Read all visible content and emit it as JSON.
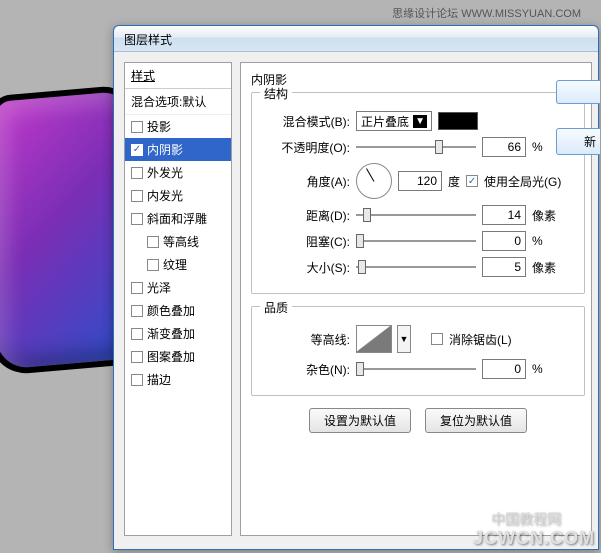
{
  "credits": {
    "top": "思缘设计论坛  WWW.MISSYUAN.COM",
    "bottom_cn": "中国教程网",
    "bottom": "JCWCN.COM"
  },
  "dialog": {
    "title": "图层样式",
    "leftHeader": "样式",
    "leftSub": "混合选项:默认",
    "styles": [
      {
        "label": "投影",
        "checked": false,
        "selected": false
      },
      {
        "label": "内阴影",
        "checked": true,
        "selected": true
      },
      {
        "label": "外发光",
        "checked": false,
        "selected": false
      },
      {
        "label": "内发光",
        "checked": false,
        "selected": false
      },
      {
        "label": "斜面和浮雕",
        "checked": false,
        "selected": false
      },
      {
        "label": "等高线",
        "checked": false,
        "selected": false,
        "indent": true
      },
      {
        "label": "纹理",
        "checked": false,
        "selected": false,
        "indent": true
      },
      {
        "label": "光泽",
        "checked": false,
        "selected": false
      },
      {
        "label": "颜色叠加",
        "checked": false,
        "selected": false
      },
      {
        "label": "渐变叠加",
        "checked": false,
        "selected": false
      },
      {
        "label": "图案叠加",
        "checked": false,
        "selected": false
      },
      {
        "label": "描边",
        "checked": false,
        "selected": false
      }
    ],
    "panelTitle": "内阴影",
    "structure": {
      "legend": "结构",
      "blendLabel": "混合模式(B):",
      "blendValue": "正片叠底",
      "opacityLabel": "不透明度(O):",
      "opacityValue": "66",
      "opacityUnit": "%",
      "angleLabel": "角度(A):",
      "angleValue": "120",
      "angleUnit": "度",
      "globalLightLabel": "使用全局光(G)",
      "globalLightChecked": true,
      "distanceLabel": "距离(D):",
      "distanceValue": "14",
      "distanceUnit": "像素",
      "chokeLabel": "阻塞(C):",
      "chokeValue": "0",
      "chokeUnit": "%",
      "sizeLabel": "大小(S):",
      "sizeValue": "5",
      "sizeUnit": "像素"
    },
    "quality": {
      "legend": "品质",
      "contourLabel": "等高线:",
      "antiAliasLabel": "消除锯齿(L)",
      "antiAliasChecked": false,
      "noiseLabel": "杂色(N):",
      "noiseValue": "0",
      "noiseUnit": "%"
    },
    "buttons": {
      "setDefault": "设置为默认值",
      "resetDefault": "复位为默认值"
    },
    "sideButtons": {
      "new": "新"
    }
  }
}
